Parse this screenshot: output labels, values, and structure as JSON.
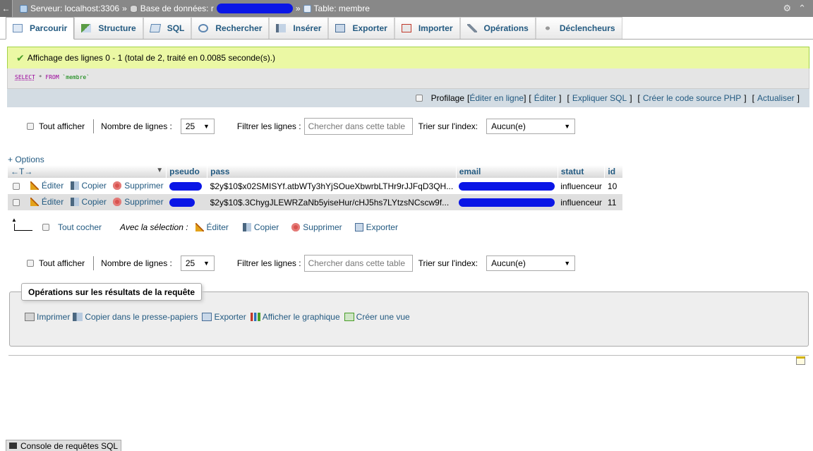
{
  "breadcrumb": {
    "server": "Serveur: localhost:3306",
    "database_prefix": "Base de données: r",
    "table": "Table: membre",
    "sep": "»"
  },
  "tabs": [
    {
      "label": "Parcourir",
      "icon": "browse-icon",
      "active": true
    },
    {
      "label": "Structure",
      "icon": "structure-icon"
    },
    {
      "label": "SQL",
      "icon": "sql-icon"
    },
    {
      "label": "Rechercher",
      "icon": "search-icon"
    },
    {
      "label": "Insérer",
      "icon": "insert-icon"
    },
    {
      "label": "Exporter",
      "icon": "export-icon"
    },
    {
      "label": "Importer",
      "icon": "import-icon"
    },
    {
      "label": "Opérations",
      "icon": "operations-icon"
    },
    {
      "label": "Déclencheurs",
      "icon": "triggers-icon"
    }
  ],
  "message": "Affichage des lignes 0 - 1 (total de 2, traité en 0.0085 seconde(s).)",
  "query": {
    "select": "SELECT",
    "star": "*",
    "from": "FROM",
    "table": "`membre`"
  },
  "query_links": {
    "profiling": "Profilage",
    "edit_inline": "Éditer en ligne",
    "edit": "Éditer",
    "explain": "Expliquer SQL",
    "php": "Créer le code source PHP",
    "refresh": "Actualiser",
    "open_bracket": "[",
    "close_bracket": "]"
  },
  "nav": {
    "show_all": "Tout afficher",
    "rows_label": "Nombre de lignes :",
    "rows_value": "25",
    "filter_label": "Filtrer les lignes :",
    "filter_placeholder": "Chercher dans cette table",
    "sort_label": "Trier sur l'index:",
    "sort_value": "Aucun(e)"
  },
  "options_link": "+ Options",
  "resize_arrows": "←T→",
  "columns": [
    "pseudo",
    "pass",
    "email",
    "statut",
    "id"
  ],
  "row_actions": {
    "edit": "Éditer",
    "copy": "Copier",
    "delete": "Supprimer"
  },
  "rows": [
    {
      "pass": "$2y$10$x02SMISYf.atbWTy3hYjSOueXbwrbLTHr9rJJFqD3QH...",
      "statut": "influenceur",
      "id": "10"
    },
    {
      "pass": "$2y$10$.3ChygJLEWRZaNb5yiseHur/cHJ5hs7LYtzsNCscw9f...",
      "statut": "influenceur",
      "id": "11"
    }
  ],
  "with_selection": {
    "check_all": "Tout cocher",
    "label": "Avec la sélection :",
    "edit": "Éditer",
    "copy": "Copier",
    "delete": "Supprimer",
    "export": "Exporter"
  },
  "query_ops": {
    "legend": "Opérations sur les résultats de la requête",
    "print": "Imprimer",
    "copy_clipboard": "Copier dans le presse-papiers",
    "export": "Exporter",
    "chart": "Afficher le graphique",
    "create_view": "Créer une vue"
  },
  "console": "Console de requêtes SQL",
  "colors": {
    "link": "#235a81",
    "success_bg": "#ebf8a4",
    "header_bar": "#888888",
    "redaction": "#0a16e6"
  }
}
